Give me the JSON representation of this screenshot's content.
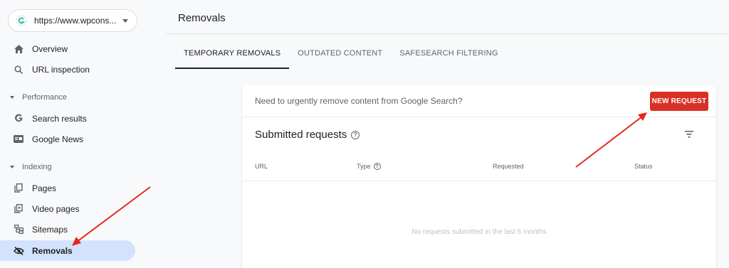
{
  "property": {
    "url": "https://www.wpcons..."
  },
  "nav": {
    "overview": "Overview",
    "url_inspection": "URL inspection",
    "performance_section": "Performance",
    "search_results": "Search results",
    "google_news": "Google News",
    "indexing_section": "Indexing",
    "pages": "Pages",
    "video_pages": "Video pages",
    "sitemaps": "Sitemaps",
    "removals": "Removals"
  },
  "header": {
    "title": "Removals"
  },
  "tabs": [
    {
      "label": "TEMPORARY REMOVALS",
      "active": true
    },
    {
      "label": "OUTDATED CONTENT",
      "active": false
    },
    {
      "label": "SAFESEARCH FILTERING",
      "active": false
    }
  ],
  "banner": {
    "text": "Need to urgently remove content from Google Search?",
    "button": "NEW REQUEST"
  },
  "submitted": {
    "title": "Submitted requests",
    "columns": [
      "URL",
      "Type",
      "Requested",
      "Status"
    ],
    "empty_message": "No requests submitted in the last 6 months"
  },
  "colors": {
    "accent": "#d93025",
    "active_nav": "#d3e3fd",
    "arrow": "#e8261c"
  },
  "icons": [
    "home-icon",
    "search-icon",
    "google-g-icon",
    "google-news-icon",
    "pages-icon",
    "video-pages-icon",
    "sitemaps-icon",
    "eye-off-icon",
    "filter-icon",
    "help-icon"
  ]
}
